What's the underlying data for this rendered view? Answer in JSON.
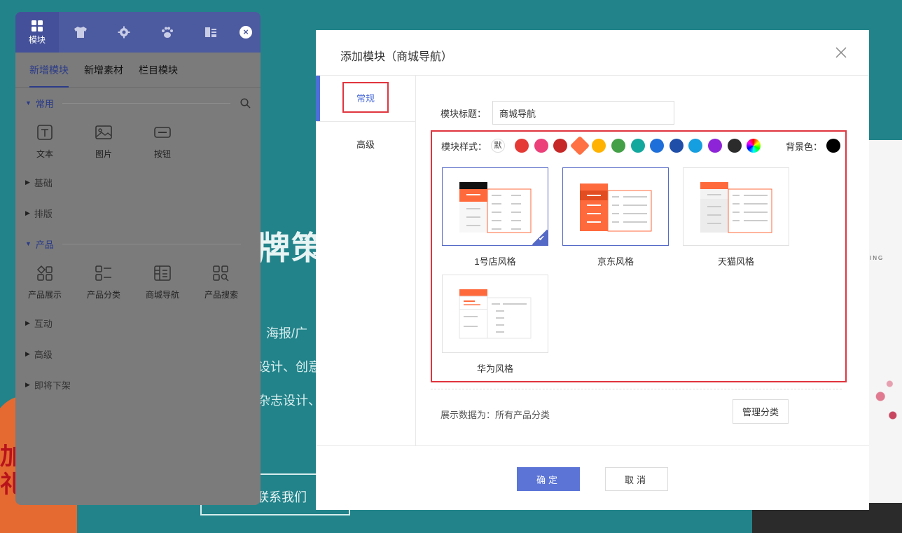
{
  "background": {
    "headline": "牌策划",
    "lines": [
      "海报/广",
      "设计、创意",
      "杂志设计、"
    ],
    "contact": "联系我们",
    "promo": "加\n礼包\n元礼包",
    "right_text": "ING"
  },
  "panel": {
    "top_tabs": [
      {
        "icon": "grid-icon",
        "label": "模块"
      },
      {
        "icon": "shirt-icon",
        "label": ""
      },
      {
        "icon": "gear-icon",
        "label": ""
      },
      {
        "icon": "paw-icon",
        "label": ""
      },
      {
        "icon": "list-icon",
        "label": ""
      }
    ],
    "close": "×",
    "sub_tabs": [
      "新增模块",
      "新增素材",
      "栏目模块"
    ],
    "sections": {
      "common": "常用",
      "basic": "基础",
      "layout": "排版",
      "product": "产品",
      "interact": "互动",
      "advanced": "高级",
      "offline": "即将下架"
    },
    "common_items": [
      "文本",
      "图片",
      "按钮"
    ],
    "product_items": [
      "产品展示",
      "产品分类",
      "商城导航",
      "产品搜索"
    ]
  },
  "modal": {
    "title": "添加模块（商城导航）",
    "side_tabs": [
      "常规",
      "高级"
    ],
    "field_label": "模块标题：",
    "field_value": "商城导航",
    "style_label": "模块样式：",
    "default_swatch": "默",
    "swatches": [
      "#e53935",
      "#ec407a",
      "#c62828",
      "#ff7043",
      "#ffb300",
      "#43a047",
      "#13a89e",
      "#1e6fd9",
      "#1e4ea8",
      "#159ee0",
      "#8e24d8",
      "#2b2b2b"
    ],
    "selected_swatch": 3,
    "bg_label": "背景色：",
    "cards": [
      "1号店风格",
      "京东风格",
      "天猫风格",
      "华为风格"
    ],
    "info_text": "展示数据为：所有产品分类",
    "manage_button": "管理分类",
    "ok": "确定",
    "cancel": "取消"
  },
  "colors": {
    "accent": "#5b74d6",
    "highlight": "#e0353e",
    "orange": "#ff6a3d"
  }
}
